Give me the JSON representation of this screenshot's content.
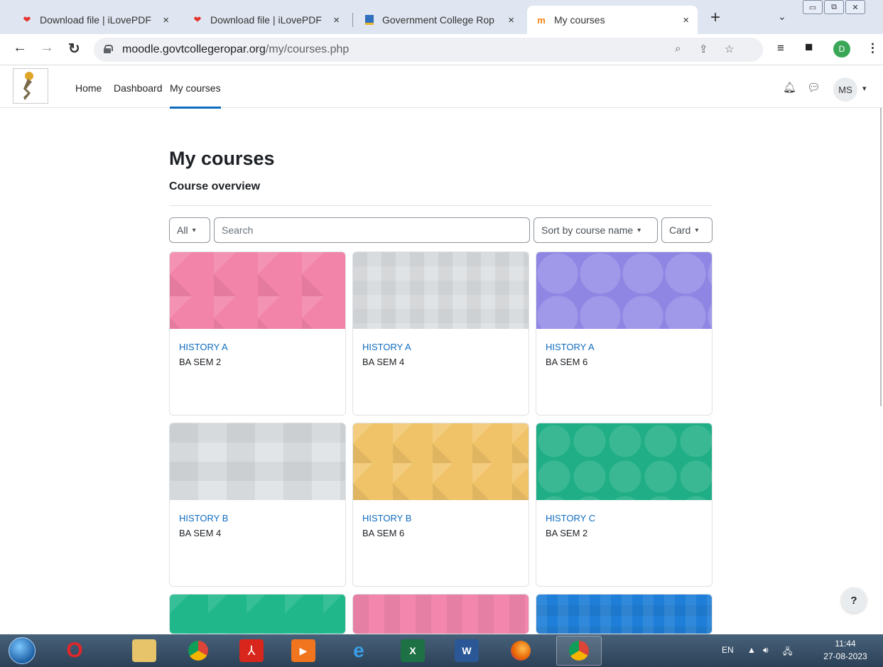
{
  "browser": {
    "tabs": [
      {
        "title": "Download file | iLovePDF",
        "close": "×"
      },
      {
        "title": "Download file | iLovePDF",
        "close": "×"
      },
      {
        "title": "Government College Rop",
        "close": "×"
      },
      {
        "title": "My courses",
        "close": "×"
      }
    ],
    "new_tab": "+",
    "tab_menu": "⌄",
    "window_buttons": [
      "▭",
      "⧉",
      "✕"
    ],
    "url_host": "moodle.govtcollegeropar.org",
    "url_path": "/my/courses.php",
    "profile_letter": "D"
  },
  "moodle_nav": {
    "links": [
      "Home",
      "Dashboard",
      "My courses"
    ],
    "active": "My courses",
    "user_initials": "MS"
  },
  "page": {
    "title": "My courses",
    "section": "Course overview"
  },
  "filters": {
    "grouping": "All",
    "search_placeholder": "Search",
    "sort": "Sort by course name",
    "view": "Card"
  },
  "courses": [
    {
      "name": "HISTORY A",
      "sub": "BA SEM 2"
    },
    {
      "name": "HISTORY A",
      "sub": "BA SEM 4"
    },
    {
      "name": "HISTORY A",
      "sub": "BA SEM 6"
    },
    {
      "name": "HISTORY B",
      "sub": "BA SEM 4"
    },
    {
      "name": "HISTORY B",
      "sub": "BA SEM 6"
    },
    {
      "name": "HISTORY C",
      "sub": "BA SEM 2"
    }
  ],
  "help_label": "?",
  "taskbar": {
    "language": "EN",
    "time": "11:44",
    "date": "27-08-2023"
  },
  "colors": {
    "link": "#0f6cbf",
    "nav_active_underline": "#0f6cbf",
    "pink": "#f283a9",
    "purple": "#8f86e4",
    "yellow": "#f1c368",
    "teal": "#1fae85",
    "blue": "#1f7fd8"
  }
}
